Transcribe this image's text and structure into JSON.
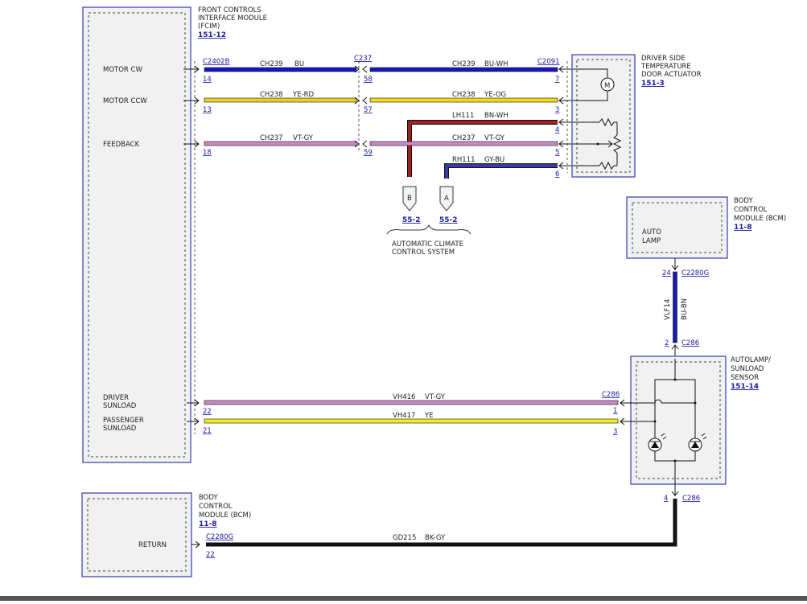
{
  "colors": {
    "BU": "#1515c8",
    "BU-WH": "#1818b8",
    "YE-RD": "#e8d22a",
    "YE-OG": "#f0dc1c",
    "VT-GY": "#c989c9",
    "BN-WH": "#a02020",
    "GY-BU": "#28285a",
    "BU-BN": "#1a1ab0",
    "YE": "#f3ef1e",
    "BK-GY": "#111111",
    "box_border": "#3a3ab0",
    "box_fill": "#f1f1f1"
  },
  "fcim": {
    "title": [
      "FRONT CONTROLS",
      "INTERFACE MODULE",
      "(FCIM)"
    ],
    "ref": "151-12",
    "pins": {
      "motor_cw": "MOTOR CW",
      "motor_ccw": "MOTOR CCW",
      "feedback": "FEEDBACK",
      "driver_sunload": [
        "DRIVER",
        "SUNLOAD"
      ],
      "passenger_sunload": [
        "PASSENGER",
        "SUNLOAD"
      ]
    }
  },
  "actuator": {
    "title": [
      "DRIVER SIDE",
      "TEMPERATURE",
      "DOOR ACTUATOR"
    ],
    "ref": "151-3",
    "motor_symbol": "M"
  },
  "bcm_top": {
    "title": [
      "BODY",
      "CONTROL",
      "MODULE (BCM)"
    ],
    "ref": "11-8",
    "inner": [
      "AUTO",
      "LAMP"
    ]
  },
  "sensor": {
    "title": [
      "AUTOLAMP/",
      "SUNLOAD",
      "SENSOR"
    ],
    "ref": "151-14"
  },
  "bcm_bottom": {
    "title": [
      "BODY",
      "CONTROL",
      "MODULE (BCM)"
    ],
    "ref": "11-8",
    "inner": "RETURN"
  },
  "accs": {
    "label": [
      "AUTOMATIC CLIMATE",
      "CONTROL SYSTEM"
    ],
    "b_letter": "B",
    "a_letter": "A",
    "b_ref": "55-2",
    "a_ref": "55-2"
  },
  "connectors": {
    "c2402b": "C2402B",
    "c237": "C237",
    "c2091": "C2091",
    "c2280g_top": "C2280G",
    "c286_top": "C286",
    "c286_sensor": "C286",
    "c286_bottom": "C286",
    "c2280g_bottom": "C2280G"
  },
  "pin_numbers": {
    "fcim_cw": "14",
    "fcim_ccw": "13",
    "fcim_fb": "18",
    "fcim_dsun": "22",
    "fcim_psun": "21",
    "c237_cw": "58",
    "c237_ccw": "57",
    "c237_fb": "59",
    "act_cw": "7",
    "act_ccw": "3",
    "act_4": "4",
    "act_5": "5",
    "act_6": "6",
    "bcm_24": "24",
    "sensor_2": "2",
    "sensor_1": "1",
    "sensor_3": "3",
    "sensor_4": "4",
    "bcm_22": "22"
  },
  "circuits": {
    "cw_left": {
      "circuit": "CH239",
      "color": "BU"
    },
    "cw_right": {
      "circuit": "CH239",
      "color": "BU-WH"
    },
    "ccw_left": {
      "circuit": "CH238",
      "color": "YE-RD"
    },
    "ccw_right": {
      "circuit": "CH238",
      "color": "YE-OG"
    },
    "fb_left": {
      "circuit": "CH237",
      "color": "VT-GY"
    },
    "fb_right": {
      "circuit": "CH237",
      "color": "VT-GY"
    },
    "lh111": {
      "circuit": "LH111",
      "color": "BN-WH"
    },
    "rh111": {
      "circuit": "RH111",
      "color": "GY-BU"
    },
    "vlf14": {
      "circuit": "VLF14",
      "color": "BU-BN"
    },
    "vh416": {
      "circuit": "VH416",
      "color": "VT-GY"
    },
    "vh417": {
      "circuit": "VH417",
      "color": "YE"
    },
    "gd215": {
      "circuit": "GD215",
      "color": "BK-GY"
    }
  }
}
